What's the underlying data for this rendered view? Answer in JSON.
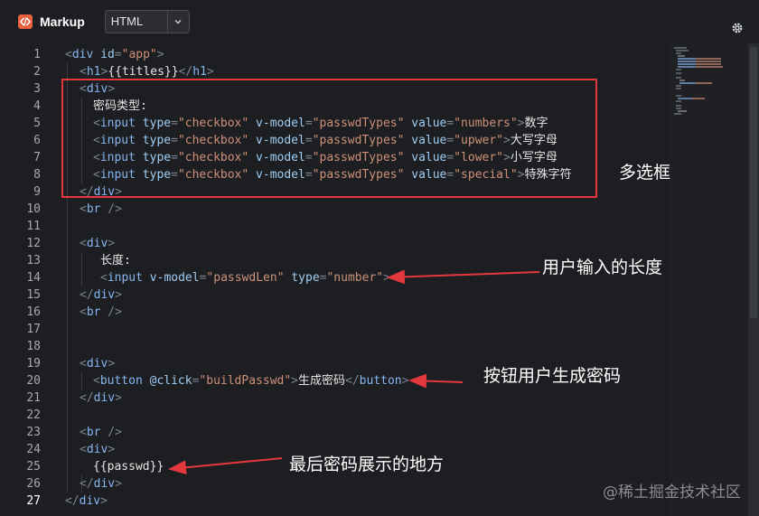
{
  "header": {
    "title": "Markup",
    "language": "HTML",
    "icons": {
      "logo": "code-brackets-icon",
      "caret": "chevron-down-icon",
      "settings": "gear-icon"
    }
  },
  "editor": {
    "line_numbers": [
      "1",
      "2",
      "3",
      "4",
      "5",
      "6",
      "7",
      "8",
      "9",
      "10",
      "11",
      "12",
      "13",
      "14",
      "15",
      "16",
      "17",
      "18",
      "19",
      "20",
      "21",
      "22",
      "23",
      "24",
      "25",
      "26",
      "27"
    ],
    "current_line": "27",
    "code": {
      "l1": [
        "<",
        "div",
        " ",
        "id",
        "=",
        "\"app\"",
        ">"
      ],
      "l2": [
        "<",
        "h1",
        ">",
        "{{titles}}",
        "</",
        "h1",
        ">"
      ],
      "l3": [
        "<",
        "div",
        ">"
      ],
      "l4": [
        "密码类型:"
      ],
      "l5": [
        "<",
        "input",
        " ",
        "type",
        "=",
        "\"checkbox\"",
        " ",
        "v-model",
        "=",
        "\"passwdTypes\"",
        " ",
        "value",
        "=",
        "\"numbers\"",
        ">",
        "数字"
      ],
      "l6": [
        "<",
        "input",
        " ",
        "type",
        "=",
        "\"checkbox\"",
        " ",
        "v-model",
        "=",
        "\"passwdTypes\"",
        " ",
        "value",
        "=",
        "\"upwer\"",
        ">",
        "大写字母"
      ],
      "l7": [
        "<",
        "input",
        " ",
        "type",
        "=",
        "\"checkbox\"",
        " ",
        "v-model",
        "=",
        "\"passwdTypes\"",
        " ",
        "value",
        "=",
        "\"lower\"",
        ">",
        "小写字母"
      ],
      "l8": [
        "<",
        "input",
        " ",
        "type",
        "=",
        "\"checkbox\"",
        " ",
        "v-model",
        "=",
        "\"passwdTypes\"",
        " ",
        "value",
        "=",
        "\"special\"",
        ">",
        "特殊字符"
      ],
      "l9": [
        "</",
        "div",
        ">"
      ],
      "l10": [
        "<",
        "br",
        " />"
      ],
      "l12": [
        "<",
        "div",
        ">"
      ],
      "l13": [
        "长度:"
      ],
      "l14": [
        "<",
        "input",
        " ",
        "v-model",
        "=",
        "\"passwdLen\"",
        " ",
        "type",
        "=",
        "\"number\"",
        ">"
      ],
      "l15": [
        "</",
        "div",
        ">"
      ],
      "l16": [
        "<",
        "br",
        " />"
      ],
      "l19": [
        "<",
        "div",
        ">"
      ],
      "l20": [
        "<",
        "button",
        " ",
        "@click",
        "=",
        "\"buildPasswd\"",
        ">",
        "生成密码",
        "</",
        "button",
        ">"
      ],
      "l21": [
        "</",
        "div",
        ">"
      ],
      "l23": [
        "<",
        "br",
        " />"
      ],
      "l24": [
        "<",
        "div",
        ">"
      ],
      "l25": [
        "{{passwd}}"
      ],
      "l26": [
        "</",
        "div",
        ">"
      ],
      "l27": [
        "</",
        "div",
        ">"
      ]
    }
  },
  "annotations": {
    "checkbox": "多选框",
    "length": "用户输入的长度",
    "button": "按钮用户生成密码",
    "result": "最后密码展示的地方",
    "color": "#e3393e"
  },
  "watermark": "@稀土掘金技术社区"
}
